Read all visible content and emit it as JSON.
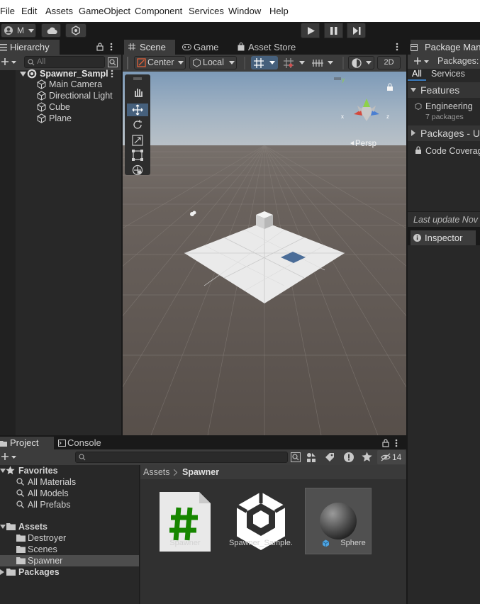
{
  "menu": [
    "File",
    "Edit",
    "Assets",
    "GameObject",
    "Component",
    "Services",
    "Window",
    "Help"
  ],
  "toolbar": {
    "account_label": "M"
  },
  "hierarchy": {
    "tab_label": "Hierarchy",
    "search_placeholder": "All",
    "scene_name": "Spawner_Sampl",
    "items": [
      {
        "label": "Main Camera"
      },
      {
        "label": "Directional Light"
      },
      {
        "label": "Cube"
      },
      {
        "label": "Plane"
      }
    ]
  },
  "scene": {
    "tabs": [
      "Scene",
      "Game",
      "Asset Store"
    ],
    "pivot_label": "Center",
    "space_label": "Local",
    "mode_2d_label": "2D",
    "persp_label": "Persp",
    "gizmo_axes": {
      "x": "x",
      "y": "y",
      "z": "z"
    }
  },
  "package_manager": {
    "tab_label": "Package Man",
    "packages_label": "Packages:",
    "filter_tabs": [
      "All",
      "Services"
    ],
    "features_header": "Features",
    "feature_name": "Engineering",
    "feature_sub": "7 packages",
    "packages_header": "Packages - U",
    "package_item": "Code Coverag",
    "last_update": "Last update Nov"
  },
  "inspector": {
    "tab_label": "Inspector"
  },
  "project": {
    "tabs": [
      "Project",
      "Console"
    ],
    "hidden_count": "14",
    "favorites_label": "Favorites",
    "favorites": [
      "All Materials",
      "All Models",
      "All Prefabs"
    ],
    "assets_label": "Assets",
    "folders": [
      "Destroyer",
      "Scenes",
      "Spawner"
    ],
    "packages_label": "Packages",
    "breadcrumb": [
      "Assets",
      "Spawner"
    ],
    "asset_items": [
      {
        "label": "Spawner"
      },
      {
        "label": "Spawner_Sample..."
      },
      {
        "label": "Sphere"
      }
    ]
  },
  "colors": {
    "selection": "#2c5d87",
    "accent_blue": "#3a79bb",
    "panel": "#282828",
    "tab_active": "#3c3c3c",
    "csharp_green": "#178600"
  }
}
